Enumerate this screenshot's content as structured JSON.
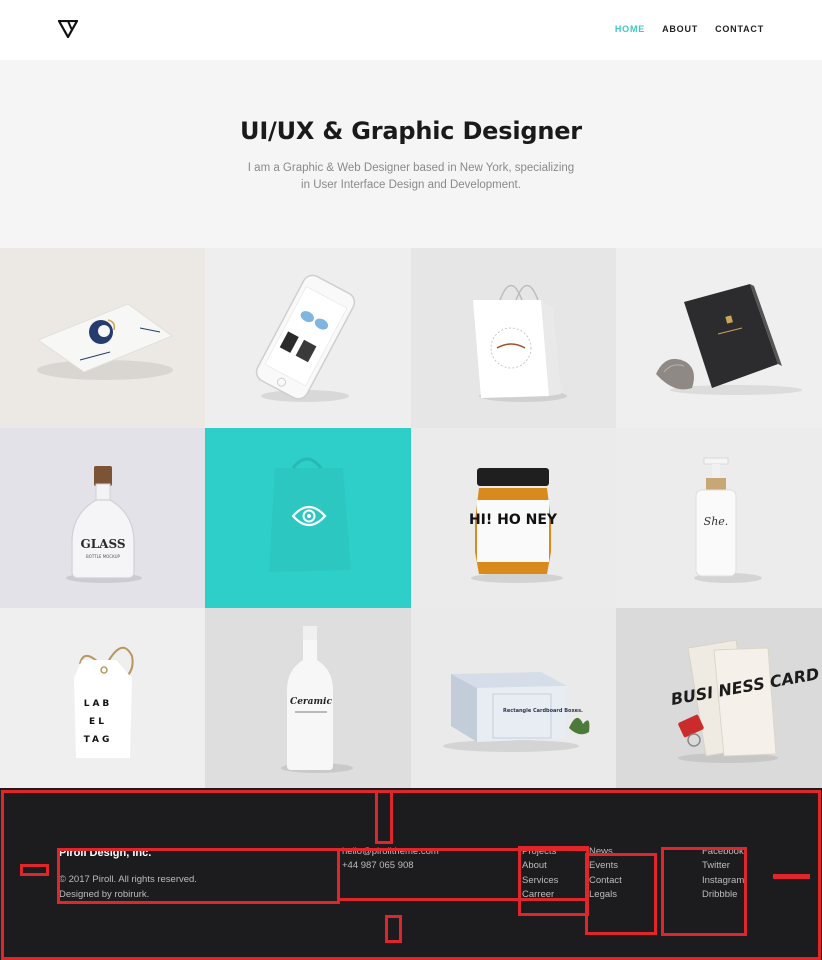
{
  "header": {
    "nav": [
      {
        "label": "HOME",
        "active": true
      },
      {
        "label": "ABOUT",
        "active": false
      },
      {
        "label": "CONTACT",
        "active": false
      }
    ]
  },
  "hero": {
    "title": "UI/UX & Graphic Designer",
    "subtitle_line1": "I am a Graphic & Web Designer based in New York, specializing",
    "subtitle_line2": "in User Interface Design and Development."
  },
  "portfolio": {
    "items": [
      {
        "name": "business-card-mockup",
        "bg": "#ece9e5"
      },
      {
        "name": "phone-mockup",
        "bg": "#eeeeee"
      },
      {
        "name": "shopping-bag-mockup",
        "bg": "#e6e6e6"
      },
      {
        "name": "book-cover-mockup",
        "bg": "#efefef"
      },
      {
        "name": "glass-bottle-mockup",
        "bg": "#e2e2e8",
        "label_top": "GLASS",
        "label_bottom": "BOTTLE MOCKUP"
      },
      {
        "name": "featured-bag-tile",
        "bg": "#2ecfc9",
        "highlight": true
      },
      {
        "name": "honey-jar-mockup",
        "bg": "#ebebeb",
        "label": "HI! HO NEY"
      },
      {
        "name": "pump-bottle-mockup",
        "bg": "#ececec",
        "label": "She."
      },
      {
        "name": "label-tag-mockup",
        "bg": "#efefef",
        "label": [
          "LAB",
          "EL",
          "TAG"
        ]
      },
      {
        "name": "ceramic-bottle-mockup",
        "bg": "#dedede",
        "label": "Ceramic"
      },
      {
        "name": "cardboard-box-mockup",
        "bg": "#eaeaea",
        "label": "Rectangle Cardboard Boxes."
      },
      {
        "name": "business-card-clip-mockup",
        "bg": "#dadada",
        "label": "BUSI NESS CARD"
      }
    ]
  },
  "footer": {
    "company": "Piroll Design, Inc.",
    "copyright": "© 2017 Piroll. All rights reserved.",
    "designer": "Designed by robirurk.",
    "email": "hello@pirolltheme.com",
    "phone": "+44 987 065 908",
    "links_col1": [
      "Projects",
      "About",
      "Services",
      "Carreer"
    ],
    "links_col2": [
      "News",
      "Events",
      "Contact",
      "Legals"
    ],
    "social": [
      "Facebook",
      "Twitter",
      "Instagram",
      "Dribbble"
    ]
  },
  "colors": {
    "accent": "#3ec9c3",
    "footer_bg": "#1c1b1d",
    "annotation": "#e0262b"
  }
}
